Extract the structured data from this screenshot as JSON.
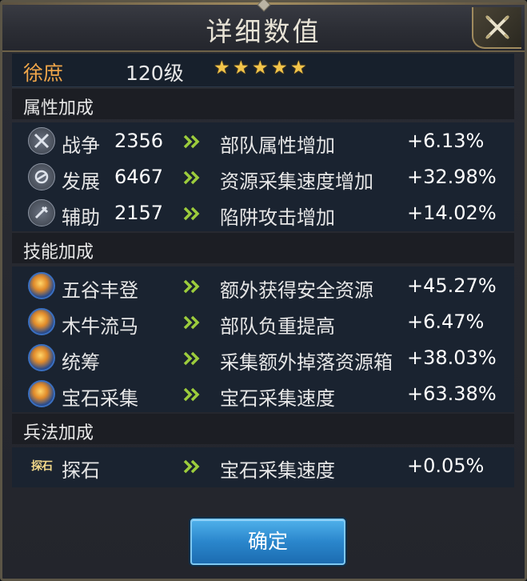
{
  "title": "详细数值",
  "hero": {
    "name": "徐庶",
    "level": "120级",
    "stars": [
      "★",
      "★",
      "★",
      "★",
      "★"
    ]
  },
  "sections": {
    "attributes": {
      "title": "属性加成",
      "rows": [
        {
          "icon": "war-icon",
          "name": "战争",
          "value": "2356",
          "desc": "部队属性增加",
          "bonus": "+6.13%"
        },
        {
          "icon": "development-icon",
          "name": "发展",
          "value": "6467",
          "desc": "资源采集速度增加",
          "bonus": "+32.98%"
        },
        {
          "icon": "support-icon",
          "name": "辅助",
          "value": "2157",
          "desc": "陷阱攻击增加",
          "bonus": "+14.02%"
        }
      ]
    },
    "skills": {
      "title": "技能加成",
      "rows": [
        {
          "icon": "harvest-skill-icon",
          "name": "五谷丰登",
          "desc": "额外获得安全资源",
          "bonus": "+45.27%"
        },
        {
          "icon": "wooden-ox-skill-icon",
          "name": "木牛流马",
          "desc": "部队负重提高",
          "bonus": "+6.47%"
        },
        {
          "icon": "planning-skill-icon",
          "name": "统筹",
          "desc": "采集额外掉落资源箱",
          "bonus": "+38.03%"
        },
        {
          "icon": "gem-gathering-skill-icon",
          "name": "宝石采集",
          "desc": "宝石采集速度",
          "bonus": "+63.38%"
        }
      ]
    },
    "tactics": {
      "title": "兵法加成",
      "rows": [
        {
          "icon": "tan-shi-icon",
          "icon_text": "探石",
          "name": "探石",
          "desc": "宝石采集速度",
          "bonus": "+0.05%"
        }
      ]
    }
  },
  "confirm_label": "确定",
  "colors": {
    "hero_name": "#f0a64a",
    "star": "#f2c44a",
    "arrow": "#9ccc3c",
    "button": "#2a86cc"
  }
}
